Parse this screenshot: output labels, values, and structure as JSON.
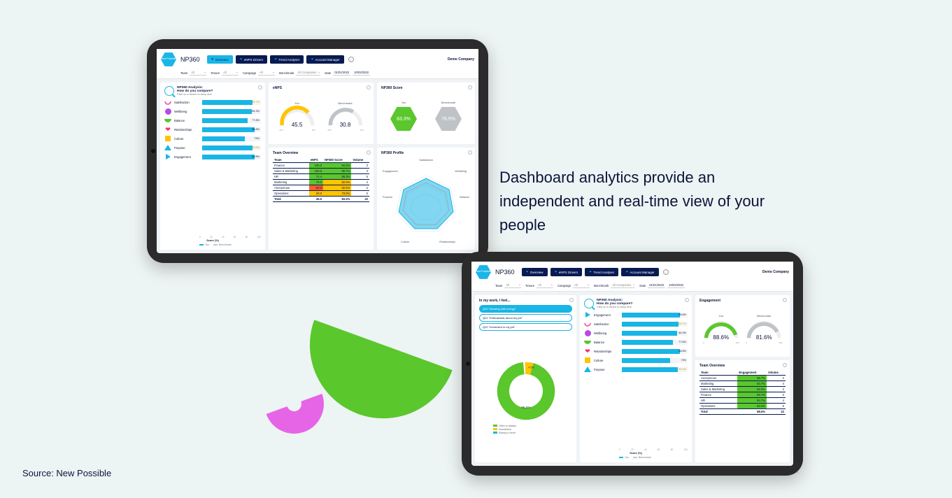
{
  "headline": "Dashboard analytics provide an independent and real-time view of your people",
  "source_label": "Source: New Possible",
  "tablet1": {
    "logo_text": "New Possible",
    "app_name": "NP360",
    "company": "Demo Company",
    "nav": {
      "overview": "Overview",
      "enps": "eNPS Drivers",
      "trend": "Trend Analyser",
      "account": "Account Manager"
    },
    "filters": {
      "team_l": "Team",
      "team_v": "All",
      "tenure_l": "Tenure",
      "tenure_v": "All",
      "campaign_l": "Campaign",
      "campaign_v": "All",
      "bench_l": "Benchmark",
      "bench_v": "All Companies",
      "date_l": "Date",
      "date_from": "01/01/2022",
      "date_to": "10/02/2022"
    },
    "enps_card": {
      "title": "eNPS",
      "you_l": "You",
      "you_v": "45.5",
      "bm_l": "Benchmark",
      "bm_v": "30.8",
      "lo": "-100",
      "hi": "100"
    },
    "score_card": {
      "title": "NP360 Score",
      "you_l": "You",
      "you_v": "83.3%",
      "bm_l": "Benchmark",
      "bm_v": "76.5%"
    },
    "team_card": {
      "title": "Team Overview",
      "headers": [
        "Team",
        "eNPS",
        "NP360 Score",
        "Volume"
      ],
      "rows": [
        {
          "team": "Finance",
          "enps": "100.0",
          "enps_c": "g",
          "score": "94.3%",
          "score_c": "g",
          "vol": "3"
        },
        {
          "team": "Sales & Marketing",
          "enps": "100.0",
          "enps_c": "g",
          "score": "90.7%",
          "score_c": "g",
          "vol": "3"
        },
        {
          "team": "HR",
          "enps": "71.4",
          "enps_c": "g",
          "score": "86.3%",
          "score_c": "g",
          "vol": "5"
        },
        {
          "team": "Marketing",
          "enps": "75.0",
          "enps_c": "g",
          "score": "82.0%",
          "score_c": "y",
          "vol": "4"
        },
        {
          "team": "Anonymous",
          "enps": "-50.0",
          "enps_c": "r",
          "score": "82.6%",
          "score_c": "y",
          "vol": "2"
        },
        {
          "team": "Operations",
          "enps": "20.0",
          "enps_c": "y",
          "score": "73.0%",
          "score_c": "y",
          "vol": "5"
        }
      ],
      "total": {
        "team": "Total",
        "enps": "45.5",
        "score": "83.3%",
        "vol": "22"
      }
    },
    "profile_card": {
      "title": "NP360 Profile",
      "axes": [
        "Satisfaction",
        "Wellbeing",
        "Balance",
        "Relationships",
        "Culture",
        "Purpose",
        "Engagement"
      ]
    },
    "analysis": {
      "title": "NP360 Analysis:",
      "sub": "How do you compare?",
      "hint": "Click on a theme to deep dive",
      "xlabel": "Score (%)",
      "leg_you": "You",
      "leg_bm": "Benchmark",
      "themes": [
        {
          "name": "Satisfaction",
          "you": 85.7,
          "bm": 78,
          "icon": "smile",
          "color": "#e84a9b",
          "gold": true
        },
        {
          "name": "Wellbeing",
          "you": 84.3,
          "bm": 77,
          "icon": "circle",
          "color": "#b84ae6"
        },
        {
          "name": "Balance",
          "you": 77.8,
          "bm": 72,
          "icon": "half",
          "color": "#5ac72c"
        },
        {
          "name": "Relationships",
          "you": 88.8,
          "bm": 80,
          "icon": "heart",
          "color": "#ff2d6b"
        },
        {
          "name": "Culture",
          "you": 73.0,
          "bm": 69,
          "icon": "square",
          "color": "#ffc400"
        },
        {
          "name": "Purpose",
          "you": 85.6,
          "bm": 78,
          "icon": "triangle",
          "color": "#19b5e6",
          "gold": true
        },
        {
          "name": "Engagement",
          "you": 88.8,
          "bm": 80,
          "icon": "play",
          "color": "#19b5e6"
        }
      ]
    },
    "footer": "22"
  },
  "tablet2": {
    "logo_text": "New Possible",
    "app_name": "NP360",
    "company": "Demo Company",
    "nav": {
      "overview": "Overview",
      "enps": "eNPS Drivers",
      "trend": "Trend Analyser",
      "account": "Account Manager"
    },
    "filters": {
      "team_l": "Team",
      "team_v": "All",
      "tenure_l": "Tenure",
      "tenure_v": "All",
      "campaign_l": "Campaign",
      "campaign_v": "All",
      "bench_l": "Benchmark",
      "bench_v": "All Companies",
      "date_l": "Date",
      "date_from": "01/01/2022",
      "date_to": "10/02/2022"
    },
    "eng_card": {
      "title": "Engagement",
      "you_l": "You",
      "you_v": "88.6%",
      "bm_l": "Benchmark",
      "bm_v": "81.6%",
      "lo": "0",
      "hi": "100"
    },
    "feel_card": {
      "title": "In my work, I feel...",
      "q": [
        {
          "id": "Q20",
          "text": "\"Bursting with energy\"",
          "active": true
        },
        {
          "id": "Q21",
          "text": "\"Enthusiastic about my job\""
        },
        {
          "id": "Q22",
          "text": "\"Immersed in my job\""
        }
      ],
      "donut": {
        "often": 95.5,
        "sometimes": 4.5,
        "rarely": 0.0
      },
      "legend": {
        "g": "Often to always",
        "y": "Sometimes",
        "b": "Rarely to never"
      }
    },
    "team_card": {
      "title": "Team Overview",
      "headers": [
        "Team",
        "Engagement",
        "Volume"
      ],
      "rows": [
        {
          "team": "Anonymous",
          "v": "96.7%",
          "c": "g",
          "vol": "2"
        },
        {
          "team": "Marketing",
          "v": "93.7%",
          "c": "g",
          "vol": "4"
        },
        {
          "team": "Sales & Marketing",
          "v": "92.6%",
          "c": "g",
          "vol": "3"
        },
        {
          "team": "Finance",
          "v": "90.7%",
          "c": "g",
          "vol": "3"
        },
        {
          "team": "HR",
          "v": "84.7%",
          "c": "g",
          "vol": "4"
        },
        {
          "team": "Operations",
          "v": "82.0%",
          "c": "g",
          "vol": "5"
        }
      ],
      "total": {
        "team": "Total",
        "v": "88.6%",
        "vol": "22"
      }
    },
    "analysis": {
      "title": "NP360 Analysis:",
      "sub": "How do you compare?",
      "hint": "Click on a theme to deep dive",
      "xlabel": "Score (%)",
      "leg_you": "You",
      "leg_bm": "Benchmark",
      "themes": [
        {
          "name": "Engagement",
          "you": 88.8,
          "bm": 80,
          "icon": "play",
          "color": "#19b5e6"
        },
        {
          "name": "Satisfaction",
          "you": 85.7,
          "bm": 78,
          "icon": "smile",
          "color": "#e84a9b",
          "gold": true
        },
        {
          "name": "Wellbeing",
          "you": 84.3,
          "bm": 77,
          "icon": "circle",
          "color": "#b84ae6"
        },
        {
          "name": "Balance",
          "you": 77.8,
          "bm": 72,
          "icon": "half",
          "color": "#5ac72c"
        },
        {
          "name": "Relationships",
          "you": 88.8,
          "bm": 80,
          "icon": "heart",
          "color": "#ff2d6b"
        },
        {
          "name": "Culture",
          "you": 73.0,
          "bm": 69,
          "icon": "square",
          "color": "#ffc400"
        },
        {
          "name": "Purpose",
          "you": 85.6,
          "bm": 78,
          "icon": "triangle",
          "color": "#19b5e6",
          "gold": true
        }
      ]
    },
    "footer": "22"
  },
  "chart_data": [
    {
      "type": "bar",
      "title": "NP360 Analysis (tablet1)",
      "orientation": "horizontal",
      "xlabel": "Score (%)",
      "ylim": [
        0,
        100
      ],
      "categories": [
        "Satisfaction",
        "Wellbeing",
        "Balance",
        "Relationships",
        "Culture",
        "Purpose",
        "Engagement"
      ],
      "series": [
        {
          "name": "You",
          "values": [
            85.7,
            84.3,
            77.8,
            88.8,
            73.0,
            85.6,
            88.8
          ]
        },
        {
          "name": "Benchmark",
          "values": [
            78,
            77,
            72,
            80,
            69,
            78,
            80
          ]
        }
      ]
    },
    {
      "type": "gauge",
      "title": "eNPS",
      "range": [
        -100,
        100
      ],
      "series": [
        {
          "name": "You",
          "value": 45.5
        },
        {
          "name": "Benchmark",
          "value": 30.8
        }
      ]
    },
    {
      "type": "pie",
      "title": "In my work, I feel... (Q20)",
      "donut": true,
      "categories": [
        "Often to always",
        "Sometimes",
        "Rarely to never"
      ],
      "values": [
        95.5,
        4.5,
        0.0
      ]
    },
    {
      "type": "gauge",
      "title": "Engagement",
      "range": [
        0,
        100
      ],
      "series": [
        {
          "name": "You",
          "value": 88.6
        },
        {
          "name": "Benchmark",
          "value": 81.6
        }
      ]
    },
    {
      "type": "radar",
      "title": "NP360 Profile",
      "categories": [
        "Satisfaction",
        "Wellbeing",
        "Balance",
        "Relationships",
        "Culture",
        "Purpose",
        "Engagement"
      ],
      "series": [
        {
          "name": "You",
          "values": [
            85.7,
            84.3,
            77.8,
            88.8,
            73.0,
            85.6,
            88.8
          ]
        },
        {
          "name": "Benchmark",
          "values": [
            78,
            77,
            72,
            80,
            69,
            78,
            80
          ]
        }
      ]
    }
  ]
}
